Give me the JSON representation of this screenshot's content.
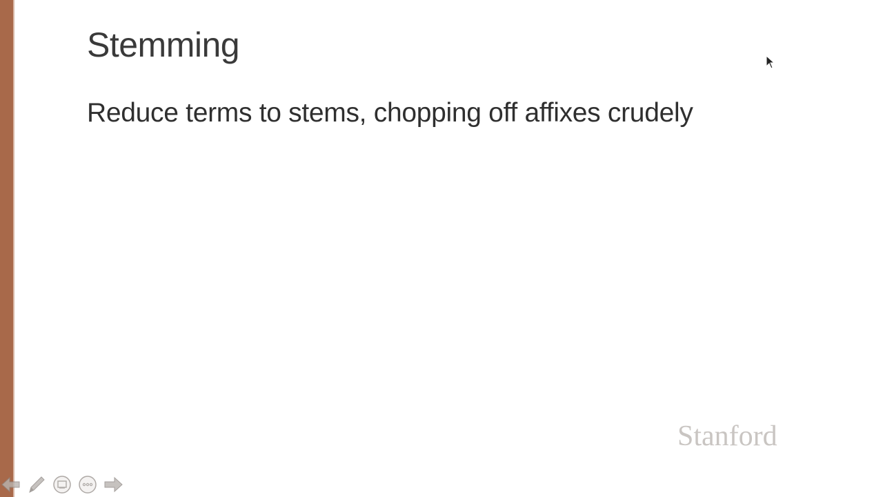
{
  "slide": {
    "title": "Stemming",
    "bullet": "Reduce terms to stems, chopping off affixes crudely",
    "logo": "Stanford"
  },
  "toolbar": {
    "buttons": [
      {
        "icon": "arrow-left-icon"
      },
      {
        "icon": "pen-icon"
      },
      {
        "icon": "slides-view-icon"
      },
      {
        "icon": "more-options-icon"
      },
      {
        "icon": "arrow-right-icon"
      }
    ]
  },
  "colors": {
    "accent_bar": "#a8694a",
    "title_text": "#3a3a3a",
    "body_text": "#2f2f2f",
    "logo_text": "#c9c5c2"
  }
}
